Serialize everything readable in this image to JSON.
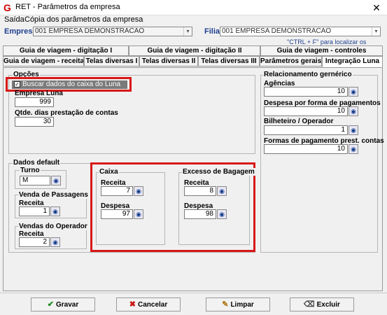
{
  "window": {
    "title": "RET - Parâmetros da empresa",
    "close_glyph": "✕",
    "logo_letter": "G"
  },
  "menu": [
    "Saída",
    "Cópia dos parâmetros da empresa"
  ],
  "header": {
    "empresa_label": "Empresa",
    "empresa_value": "001 EMPRESA DEMONSTRACAO",
    "filial_label": "Filial",
    "filial_value": "001 EMPRESA DEMONSTRACAO",
    "tip": "\"CTRL + F\" para localizar os campos"
  },
  "tabs_row1": [
    "Guia de viagem - digitação I",
    "Guia de viagem - digitação II",
    "Guia de viagem - controles"
  ],
  "tabs_row2": [
    "Guia de viagem - receita",
    "Telas diversas I",
    "Telas diversas II",
    "Telas diversas III",
    "Parâmetros gerais",
    "Integração Luna"
  ],
  "active_tab": "Integração Luna",
  "opcoes": {
    "title": "Opções",
    "buscar_label": "Buscar dados do caixa do Luna",
    "buscar_checked": true,
    "empresa_luna_label": "Empresa Luna",
    "empresa_luna_value": "999",
    "qtde_label": "Qtde. dias prestação de contas",
    "qtde_value": "30"
  },
  "relacionamento": {
    "title": "Relacionamento gernérico",
    "agencias_label": "Agências",
    "agencias_value": "10",
    "despesa_label": "Despesa por forma de pagamentos",
    "despesa_value": "10",
    "bilheteiro_label": "Bilheteiro / Operador",
    "bilheteiro_value": "1",
    "formas_label": "Formas de pagamento prest. contas",
    "formas_value": "10"
  },
  "dados_default": {
    "title": "Dados default",
    "turno_label": "Turno",
    "turno_value": "M",
    "venda_title": "Venda de Passagens",
    "venda_receita_label": "Receita",
    "venda_receita_value": "1",
    "vendas_op_title": "Vendas do Operador",
    "vendas_op_receita_label": "Receita",
    "vendas_op_receita_value": "2",
    "caixa_title": "Caixa",
    "caixa_receita_label": "Receita",
    "caixa_receita_value": "7",
    "caixa_despesa_label": "Despesa",
    "caixa_despesa_value": "97",
    "excesso_title": "Excesso de Bagagem",
    "excesso_receita_label": "Receita",
    "excesso_receita_value": "8",
    "excesso_despesa_label": "Despesa",
    "excesso_despesa_value": "98"
  },
  "buttons": {
    "gravar": "Gravar",
    "cancelar": "Cancelar",
    "limpar": "Limpar",
    "excluir": "Excluir"
  },
  "icons": {
    "lookup": "binoculars-icon",
    "combo_arrow": "▾",
    "check": "✓",
    "gravar": "✔",
    "cancelar": "✖",
    "limpar": "✎",
    "excluir": "⌫"
  },
  "colors": {
    "highlight": "#d81818",
    "label_blue": "#1f3f8f"
  }
}
